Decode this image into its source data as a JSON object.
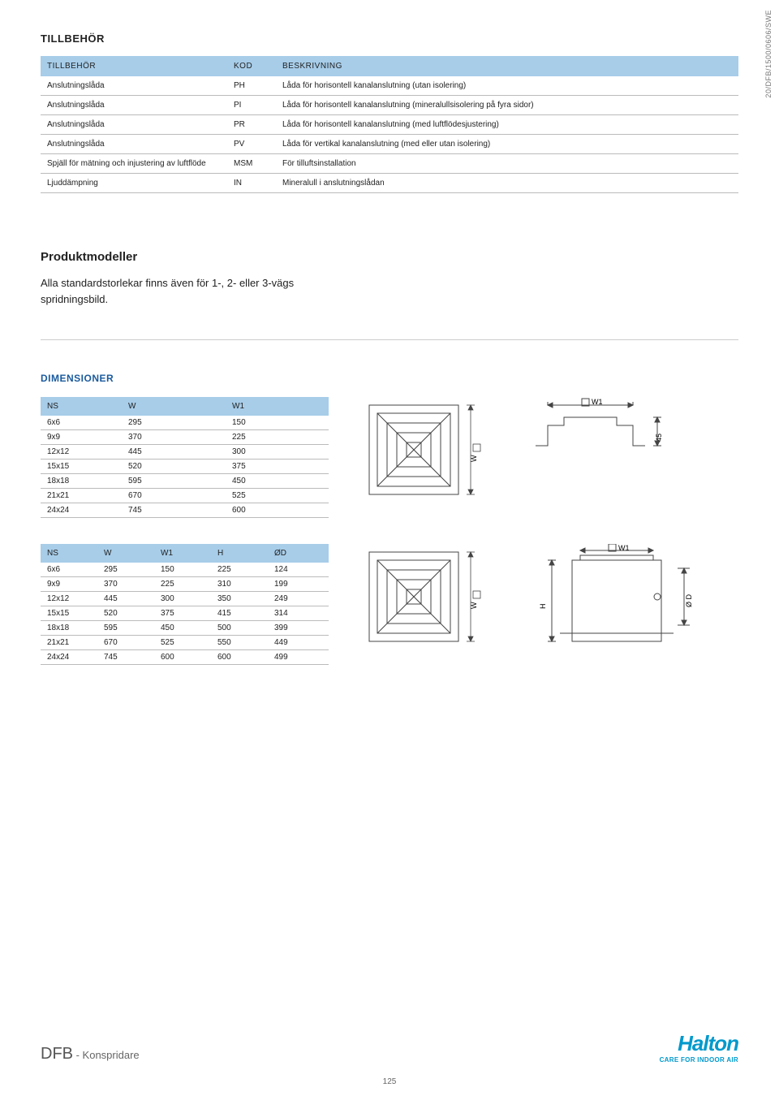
{
  "side_code": "20/DFB/1500/0606/SWE",
  "section1_title": "TILLBEHÖR",
  "table1": {
    "headers": [
      "TILLBEHÖR",
      "KOD",
      "BESKRIVNING"
    ],
    "rows": [
      [
        "Anslutningslåda",
        "PH",
        "Låda för horisontell kanalanslutning (utan isolering)"
      ],
      [
        "Anslutningslåda",
        "PI",
        "Låda för horisontell kanalanslutning (mineralullsisolering på fyra sidor)"
      ],
      [
        "Anslutningslåda",
        "PR",
        "Låda för horisontell kanalanslutning (med luftflödesjustering)"
      ],
      [
        "Anslutningslåda",
        "PV",
        "Låda för vertikal kanalanslutning (med eller utan isolering)"
      ],
      [
        "Spjäll för mätning och injustering av luftflöde",
        "MSM",
        "För tilluftsinstallation"
      ],
      [
        "Ljuddämpning",
        "IN",
        "Mineralull i anslutningslådan"
      ]
    ]
  },
  "pm_title": "Produktmodeller",
  "pm_text1": "Alla standardstorlekar finns även för 1-, 2- eller 3-vägs",
  "pm_text2": "spridningsbild.",
  "dims_title": "DIMENSIONER",
  "tableA": {
    "headers": [
      "NS",
      "W",
      "W1"
    ],
    "rows": [
      [
        "6x6",
        "295",
        "150"
      ],
      [
        "9x9",
        "370",
        "225"
      ],
      [
        "12x12",
        "445",
        "300"
      ],
      [
        "15x15",
        "520",
        "375"
      ],
      [
        "18x18",
        "595",
        "450"
      ],
      [
        "21x21",
        "670",
        "525"
      ],
      [
        "24x24",
        "745",
        "600"
      ]
    ]
  },
  "tableB": {
    "headers": [
      "NS",
      "W",
      "W1",
      "H",
      "ØD"
    ],
    "rows": [
      [
        "6x6",
        "295",
        "150",
        "225",
        "124"
      ],
      [
        "9x9",
        "370",
        "225",
        "310",
        "199"
      ],
      [
        "12x12",
        "445",
        "300",
        "350",
        "249"
      ],
      [
        "15x15",
        "520",
        "375",
        "415",
        "314"
      ],
      [
        "18x18",
        "595",
        "450",
        "500",
        "399"
      ],
      [
        "21x21",
        "670",
        "525",
        "550",
        "449"
      ],
      [
        "24x24",
        "745",
        "600",
        "600",
        "499"
      ]
    ]
  },
  "dia_labels": {
    "W": "W",
    "W1": "W1",
    "H": "H",
    "OD": "Ø D",
    "d45": "45"
  },
  "footer_big": "DFB",
  "footer_small": " - Konspridare",
  "logo_name": "Halton",
  "logo_tag": "CARE FOR INDOOR AIR",
  "page_num": "125"
}
